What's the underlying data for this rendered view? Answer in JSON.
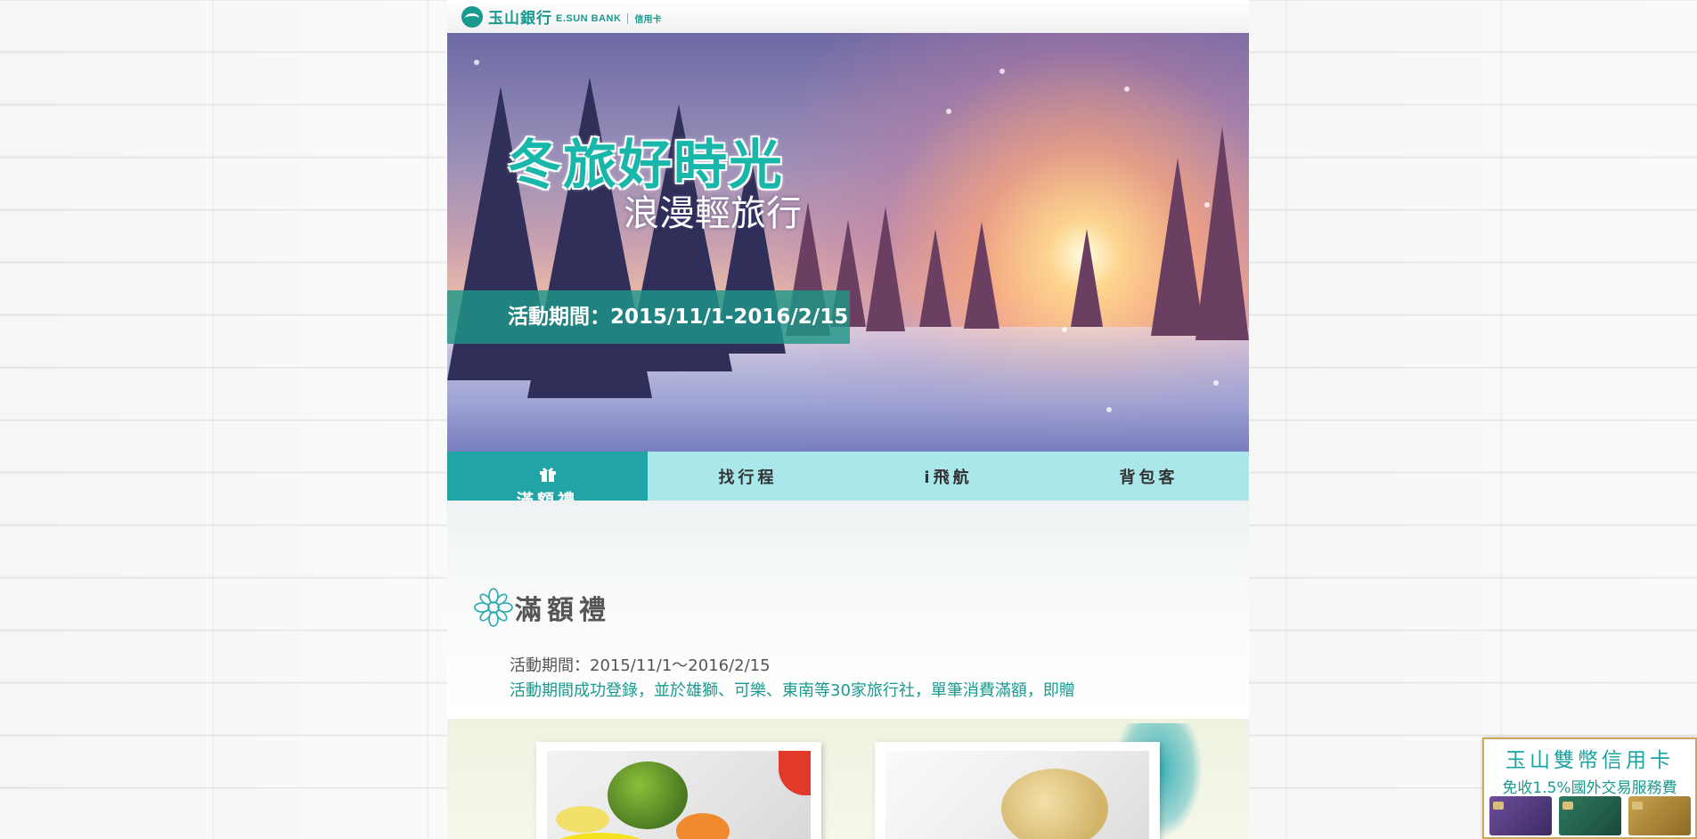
{
  "header": {
    "logo_cn": "玉山銀行",
    "logo_en": "E.SUN BANK",
    "logo_section": "信用卡"
  },
  "hero": {
    "title": "冬旅好時光",
    "subtitle": "浪漫輕旅行",
    "period": "活動期間：2015/11/1-2016/2/15"
  },
  "nav": {
    "tabs": [
      {
        "label": "滿額禮",
        "active": true,
        "icon": "gift-icon"
      },
      {
        "label": "找行程",
        "active": false
      },
      {
        "label": "i飛航",
        "active": false
      },
      {
        "label": "背包客",
        "active": false
      }
    ]
  },
  "section": {
    "title": "滿額禮",
    "period": "活動期間：2015/11/1～2016/2/15",
    "description": "活動期間成功登錄，並於雄獅、可樂、東南等30家旅行社，單筆消費滿額，即贈"
  },
  "float_ad": {
    "title": "玉山雙幣信用卡",
    "subtitle": "免收1.5%國外交易服務費"
  },
  "colors": {
    "brand_teal": "#1a9a8f",
    "tab_active": "#21a4a6",
    "tab_bar": "#a9e7ea"
  }
}
